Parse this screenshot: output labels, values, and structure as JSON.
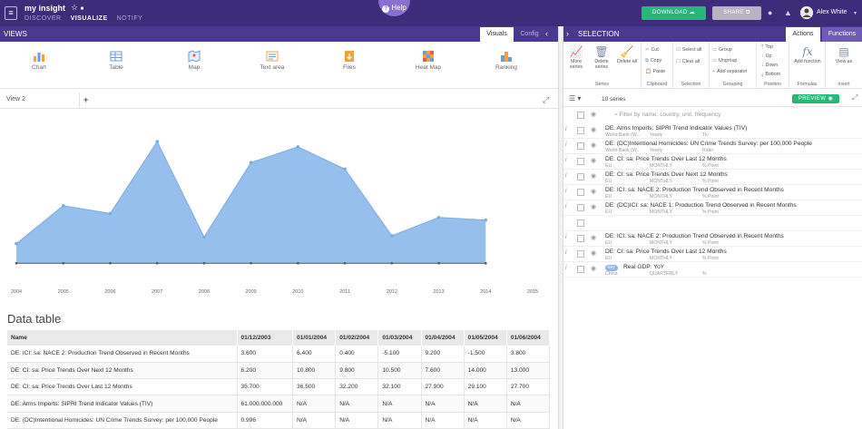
{
  "topbar": {
    "menu_icon": "≡",
    "app_title": "my insight",
    "star_icon": "☆",
    "folder_icon": "■",
    "tabs": [
      "DISCOVER",
      "VISUALIZE",
      "NOTIFY"
    ],
    "help_label": "Help",
    "download_label": "DOWNLOAD",
    "share_label": "SHARE",
    "user_name": "Alex White",
    "colors": {
      "bar": "#3d2c7a",
      "download": "#27b878",
      "share": "#b7b3c4"
    }
  },
  "views": {
    "title": "VIEWS",
    "tabs": [
      "Visuals",
      "Config"
    ],
    "collapse_icon": "‹",
    "types": [
      {
        "label": "Chart",
        "icon": "chart-icon"
      },
      {
        "label": "Table",
        "icon": "table-icon"
      },
      {
        "label": "Map",
        "icon": "map-icon"
      },
      {
        "label": "Text area",
        "icon": "text-area-icon"
      },
      {
        "label": "Files",
        "icon": "files-icon"
      },
      {
        "label": "Heat Map",
        "icon": "heat-map-icon"
      },
      {
        "label": "Ranking",
        "icon": "ranking-icon"
      }
    ],
    "active_view": "View 2",
    "add_icon": "+",
    "expand_icon": "⤢"
  },
  "chart_data": {
    "type": "area",
    "x": [
      "2004",
      "2005",
      "2006",
      "2007",
      "2008",
      "2009",
      "2010",
      "2011",
      "2012",
      "2013",
      "2014",
      "2015"
    ],
    "series": [
      {
        "values": [
          7.5,
          22,
          19,
          46.5,
          10,
          38.5,
          44.5,
          36,
          10.5,
          17.5,
          16.5
        ]
      }
    ],
    "ylim": [
      -2,
      50
    ],
    "color": "#96bfee",
    "line_color": "#7aaee3"
  },
  "data_table": {
    "title": "Data table",
    "columns": [
      "Name",
      "01/12/2003",
      "01/01/2004",
      "01/02/2004",
      "01/03/2004",
      "01/04/2004",
      "01/05/2004",
      "01/06/2004"
    ],
    "rows": [
      [
        "DE: ICI: sa: NACE 2: Production Trend Observed in Recent Months",
        "3.600",
        "6.400",
        "0.400",
        "-5.100",
        "9.200",
        "-1.500",
        "3.800"
      ],
      [
        "DE: CI: sa: Price Trends Over Next 12 Months",
        "6.200",
        "10.800",
        "9.800",
        "10.500",
        "7.600",
        "14.000",
        "13.000"
      ],
      [
        "DE: CI: sa: Price Trends Over Last 12 Months",
        "35.700",
        "36.500",
        "32.200",
        "32.100",
        "27.900",
        "29.100",
        "27.700"
      ],
      [
        "DE: Arms Imports: SIPRI Trend Indicator Values (TIV)",
        "61.000.000.000",
        "N/A",
        "N/A",
        "N/A",
        "N/A",
        "N/A",
        "N/A"
      ],
      [
        "DE: (DC)Intentional Homicides: UN Crime Trends Survey: per 100,000 People",
        "0.996",
        "N/A",
        "N/A",
        "N/A",
        "N/A",
        "N/A",
        "N/A"
      ]
    ]
  },
  "selection": {
    "title": "SELECTION",
    "tabs": [
      "Actions",
      "Functions"
    ],
    "collapse_icon": "›",
    "ribbon": {
      "series_group": "Series",
      "more_series": "More series",
      "delete_series": "Delete series",
      "delete_all": "Delete all",
      "clipboard_group": "Clipboard",
      "cut": "Cut",
      "copy": "Copy",
      "paste": "Paste",
      "selection_group": "Selection",
      "select_all": "Select all",
      "clear_all": "Clear all",
      "grouping_group": "Grouping",
      "group": "Group",
      "ungroup": "Ungroup",
      "add_separator": "Add separator",
      "position_group": "Position",
      "top": "Top",
      "up": "Up",
      "down": "Down",
      "bottom": "Bottom",
      "formulas_group": "Formulas",
      "add_function": "Add function",
      "insert_group": "Insert",
      "view_as": "View as"
    },
    "series_count": "10 series",
    "preview_label": "PREVIEW",
    "filter_placeholder": "Filter by name, country, unit, frequency",
    "series": [
      {
        "name": "DE: Arms Imports: SIPRI Trend Indicator Values (TIV)",
        "source": "World Bank (W...",
        "freq": "Yearly",
        "unit": "Tiv"
      },
      {
        "name": "DE: (DC)Intentional Homicides: UN Crime Trends Survey: per 100,000 People",
        "source": "World Bank (W...",
        "freq": "Yearly",
        "unit": "Ratio"
      },
      {
        "name": "DE: CI: sa: Price Trends Over Last 12 Months",
        "source": "EU",
        "freq": "MONTHLY",
        "unit": "% Point"
      },
      {
        "name": "DE: CI: sa: Price Trends Over Next 12 Months",
        "source": "EU",
        "freq": "MONTHLY",
        "unit": "% Point"
      },
      {
        "name": "DE: ICI: sa: NACE 2: Production Trend Observed in Recent Months",
        "source": "EU",
        "freq": "MONTHLY",
        "unit": "% Point"
      },
      {
        "name": "DE: (DC)ICI: sa: NACE 1: Production Trend Observed in Recent Months",
        "source": "EU",
        "freq": "MONTHLY",
        "unit": "% Point"
      },
      {
        "name": "",
        "source": "",
        "freq": "",
        "unit": ""
      },
      {
        "name": "DE: ICI: sa: NACE 2: Production Trend Observed in Recent Months",
        "source": "EU",
        "freq": "MONTHLY",
        "unit": "% Point"
      },
      {
        "name": "DE: CI: sa: Price Trends Over Last 12 Months",
        "source": "EU",
        "freq": "MONTHLY",
        "unit": "% Point"
      },
      {
        "name": "Real GDP: YoY",
        "source": "China",
        "freq": "QUARTERLY",
        "unit": "%",
        "badge": "key"
      }
    ]
  }
}
